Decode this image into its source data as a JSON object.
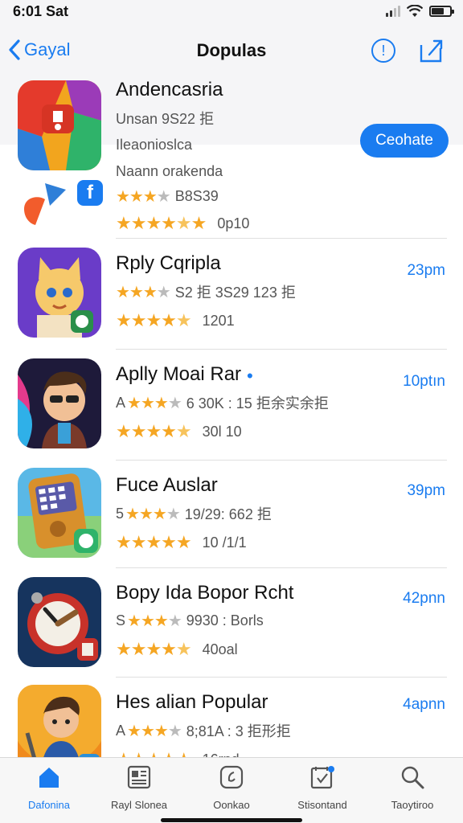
{
  "status": {
    "time": "6:01 Sat"
  },
  "nav": {
    "back_label": "Gayal",
    "title": "Dopulas"
  },
  "featured": {
    "name": "Andencasria",
    "line1": "Unsan 9S22 拒",
    "line2": "Ileaonioslca",
    "line3": "Naann orakenda",
    "rating_text": "B8S39",
    "review_text": "0p10",
    "button_label": "Ceohate"
  },
  "apps": [
    {
      "name": "Rply Cqripla",
      "meta": "S2 拒 3S29 123 拒",
      "rating_text": "1201",
      "time": "23pm"
    },
    {
      "name": "Aplly Moai Rar",
      "meta": "6 30K : 15 拒余实余拒",
      "rating_text": "30l 10",
      "time": "10ptın"
    },
    {
      "name": "Fuce Auslar",
      "meta": "19/29: 662 拒",
      "rating_text": "10 /1/1",
      "time": "39pm"
    },
    {
      "name": "Bopy Ida Bopor Rcht",
      "meta": "9930 : Borls",
      "rating_text": "40oal",
      "time": "42pnn"
    },
    {
      "name": "Hes alian Popular",
      "meta": "8;81A : 3 拒形拒",
      "rating_text": "16rnd",
      "time": "4apnn"
    }
  ],
  "tabs": [
    {
      "label": "Dafonina",
      "icon": "home-icon"
    },
    {
      "label": "Rayl Slonea",
      "icon": "list-icon"
    },
    {
      "label": "Oonkao",
      "icon": "app-icon"
    },
    {
      "label": "Stisontand",
      "icon": "calendar-icon"
    },
    {
      "label": "Taoytiroo",
      "icon": "search-icon"
    }
  ],
  "colors": {
    "accent": "#1a7cf0",
    "star": "#f5a623"
  }
}
